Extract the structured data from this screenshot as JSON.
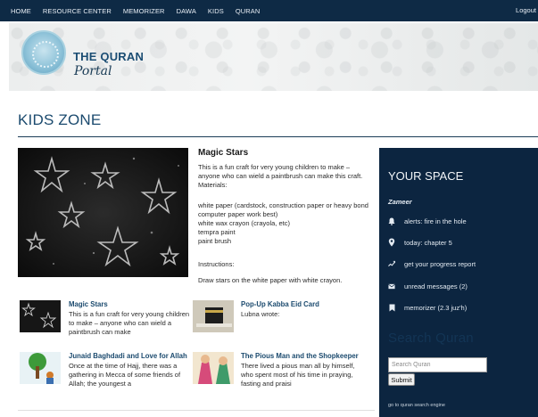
{
  "nav": {
    "items": [
      "HOME",
      "RESOURCE CENTER",
      "MEMORIZER",
      "DAWA",
      "KIDS",
      "QURAN"
    ],
    "logout": "Logout"
  },
  "logo": {
    "title": "THE QURAN",
    "subtitle": "Portal"
  },
  "page": {
    "title": "KIDS ZONE"
  },
  "featured": {
    "title": "Magic Stars",
    "intro": "This is a fun craft for very young children to make – anyone who can wield a paintbrush can make this craft. Materials:",
    "materials": [
      "white paper (cardstock, construction paper or heavy bond computer paper work best)",
      "white wax crayon (crayola, etc)",
      "tempra paint",
      "paint brush"
    ],
    "instructions_label": "Instructions:",
    "instruction_1": "Draw stars on the white paper with white crayon."
  },
  "articles": [
    {
      "title": "Magic Stars",
      "text": "This is a fun craft for very young children to make – anyone who can wield a paintbrush can make"
    },
    {
      "title": "Pop-Up Kabba Eid Card",
      "text": "Lubna wrote:"
    },
    {
      "title": "Junaid Baghdadi and Love for Allah",
      "text": "Once at the time of Hajj, there was a gathering in Mecca of some friends of Allah; the youngest a"
    },
    {
      "title": "The Pious Man and the Shopkeeper",
      "text": "There lived a pious man all by himself, who spent most of his time in praying, fasting and praisi"
    }
  ],
  "sidebar": {
    "title": "YOUR SPACE",
    "user": "Zameer",
    "items": [
      {
        "label": "alerts: fire in the hole",
        "icon": "bell-icon"
      },
      {
        "label": "today: chapter 5",
        "icon": "location-pin-icon"
      },
      {
        "label": "get your progress report",
        "icon": "trend-icon"
      },
      {
        "label": "unread messages (2)",
        "icon": "envelope-icon"
      },
      {
        "label": "memorizer (2.3 juz'h)",
        "icon": "bookmark-icon"
      }
    ],
    "search_title": "Search Quran",
    "search_placeholder": "Search Quran",
    "submit_label": "Submit",
    "footer": "go to quran search engine"
  },
  "colors": {
    "nav_bg": "#0e2a45",
    "sidebar_bg": "#0c2540",
    "title": "#1b4a6e",
    "link": "#1b4a6e"
  }
}
